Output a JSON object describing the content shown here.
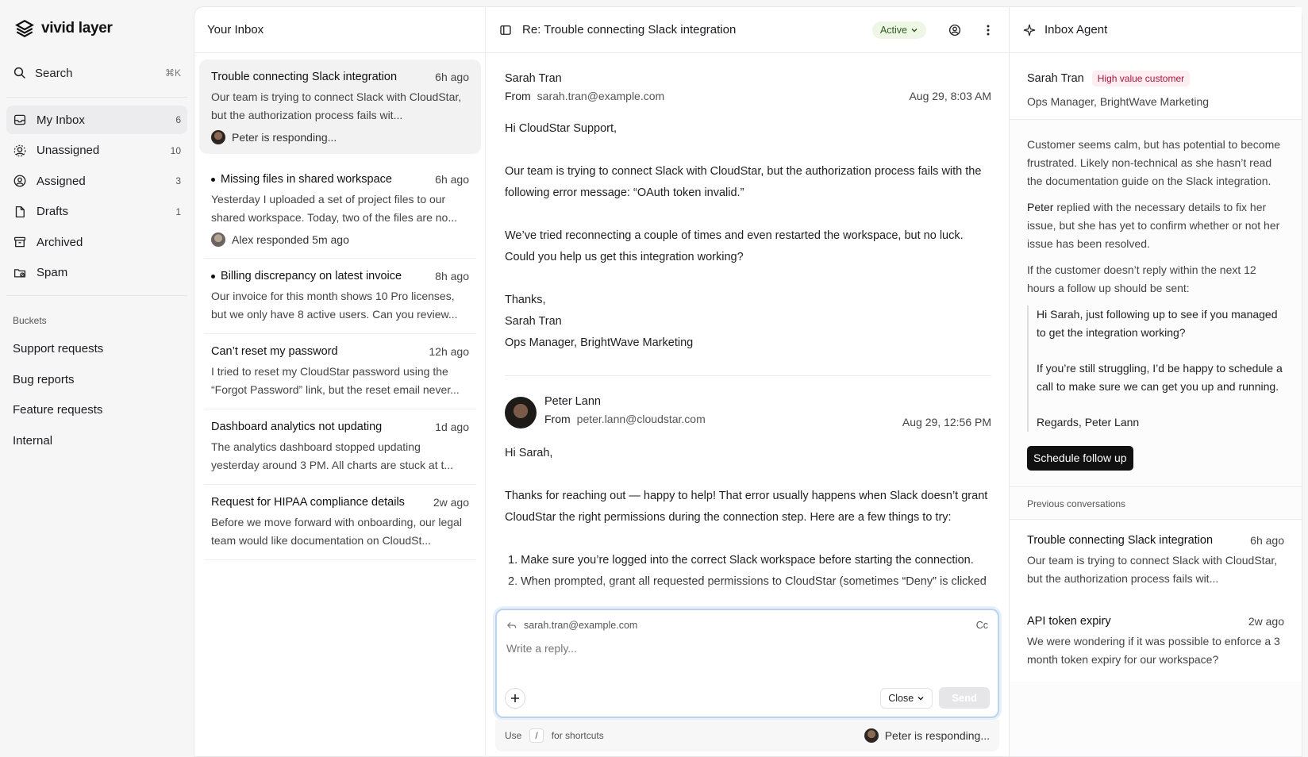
{
  "brand": {
    "name": "vivid layer"
  },
  "search": {
    "label": "Search",
    "shortcut": "⌘K"
  },
  "nav": [
    {
      "label": "My Inbox",
      "count": "6",
      "icon": "inbox-icon"
    },
    {
      "label": "Unassigned",
      "count": "10",
      "icon": "unassigned-icon"
    },
    {
      "label": "Assigned",
      "count": "3",
      "icon": "assigned-icon"
    },
    {
      "label": "Drafts",
      "count": "1",
      "icon": "draft-icon"
    },
    {
      "label": "Archived",
      "count": "",
      "icon": "archive-icon"
    },
    {
      "label": "Spam",
      "count": "",
      "icon": "spam-icon"
    }
  ],
  "buckets": {
    "heading": "Buckets",
    "items": [
      "Support requests",
      "Bug reports",
      "Feature requests",
      "Internal"
    ]
  },
  "inbox": {
    "title": "Your Inbox",
    "conversations": [
      {
        "title": "Trouble connecting Slack integration",
        "time": "6h ago",
        "snippet": "Our team is trying to connect Slack with CloudStar, but the authorization process fails wit...",
        "footer": "Peter is responding...",
        "unread": false
      },
      {
        "title": "Missing files in shared workspace",
        "time": "6h ago",
        "snippet": "Yesterday I uploaded a set of project files to our shared workspace. Today, two of the files are no...",
        "footer": "Alex responded 5m ago",
        "unread": true
      },
      {
        "title": "Billing discrepancy on latest invoice",
        "time": "8h ago",
        "snippet": "Our invoice for this month shows 10 Pro licenses, but we only have 8 active users. Can you review...",
        "footer": "",
        "unread": true
      },
      {
        "title": "Can’t reset my password",
        "time": "12h ago",
        "snippet": "I tried to reset my CloudStar password using the “Forgot Password” link, but the reset email never...",
        "footer": "",
        "unread": false
      },
      {
        "title": "Dashboard analytics not updating",
        "time": "1d ago",
        "snippet": "The analytics dashboard stopped updating yesterday around 3 PM. All charts are stuck at t...",
        "footer": "",
        "unread": false
      },
      {
        "title": "Request for HIPAA compliance details",
        "time": "2w ago",
        "snippet": "Before we move forward with onboarding, our legal team would like documentation on CloudSt...",
        "footer": "",
        "unread": false
      }
    ]
  },
  "thread": {
    "title": "Re: Trouble connecting Slack integration",
    "status": "Active",
    "messages": [
      {
        "name": "Sarah Tran",
        "from_label": "From",
        "email": "sarah.tran@example.com",
        "date": "Aug 29, 8:03 AM",
        "paragraphs": [
          "Hi CloudStar Support,",
          "Our team is trying to connect Slack with CloudStar, but the authorization process fails with the following error message: “OAuth token invalid.”",
          "We’ve tried reconnecting a couple of times and even restarted the workspace, but no luck. Could you help us get this integration working?",
          "Thanks,\nSarah Tran\nOps Manager, BrightWave Marketing"
        ]
      },
      {
        "name": "Peter Lann",
        "from_label": "From",
        "email": "peter.lann@cloudstar.com",
        "date": "Aug 29, 12:56 PM",
        "paragraphs": [
          "Hi Sarah,",
          "Thanks for reaching out — happy to help! That error usually happens when Slack doesn’t grant CloudStar the right permissions during the connection step. Here are a few things to try:",
          "1. Make sure you’re logged into the correct Slack workspace before starting the connection.\n2. When prompted, grant all requested permissions to CloudStar (sometimes “Deny” is clicked"
        ]
      }
    ]
  },
  "composer": {
    "to": "sarah.tran@example.com",
    "cc": "Cc",
    "placeholder": "Write a reply...",
    "close_label": "Close",
    "send_label": "Send",
    "shortcut_pre": "Use",
    "shortcut_key": "/",
    "shortcut_post": "for shortcuts",
    "responding": "Peter is responding..."
  },
  "agent": {
    "title": "Inbox Agent",
    "customer_name": "Sarah Tran",
    "customer_badge": "High value customer",
    "customer_role": "Ops Manager, BrightWave Marketing",
    "summary_1": "Customer seems calm, but has potential to become frustrated. Likely non-technical as she hasn’t read the documentation guide on the Slack integration.",
    "summary_2_name": "Peter",
    "summary_2": " replied with the necessary details to fix her issue, but she has yet to confirm whether or not her issue has been resolved.",
    "summary_3": "If the customer doesn’t reply within the next 12 hours a follow up should be sent:",
    "draft": [
      "Hi Sarah, just following up to see if you managed to get the integration working?",
      "If you’re still struggling, I’d be happy to schedule a call to make sure we can get you up and running.",
      "Regards, Peter Lann"
    ],
    "schedule_label": "Schedule follow up",
    "previous_heading": "Previous conversations",
    "previous": [
      {
        "title": "Trouble connecting Slack integration",
        "time": "6h ago",
        "snippet": "Our team is trying to connect Slack with CloudStar, but the authorization process fails wit..."
      },
      {
        "title": "API token expiry",
        "time": "2w ago",
        "snippet": "We were wondering if it was possible to enforce a 3 month token expiry for our workspace?"
      }
    ]
  },
  "colors": {
    "active_pill_bg": "#eef6e6",
    "badge_text": "#b1133d",
    "composer_focus": "#bcd3ef"
  }
}
